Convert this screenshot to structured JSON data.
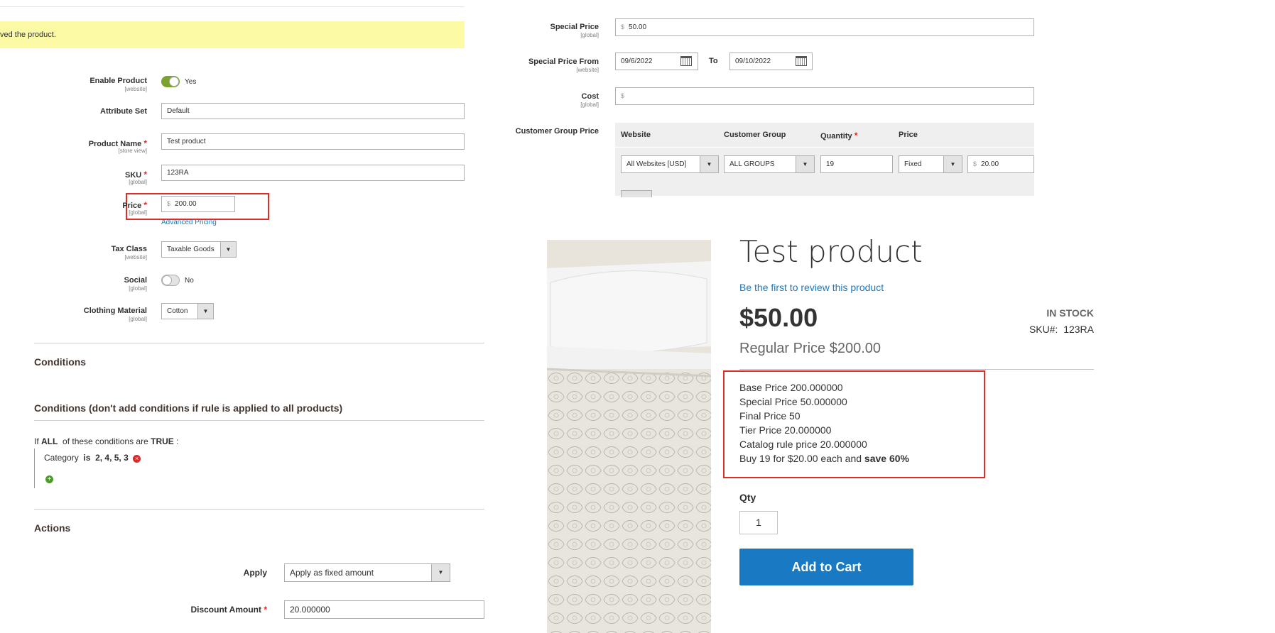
{
  "admin": {
    "success_message": "ved the product.",
    "fields": {
      "enable_product": {
        "label": "Enable Product",
        "scope": "[website]",
        "value": "Yes"
      },
      "attribute_set": {
        "label": "Attribute Set",
        "value": "Default"
      },
      "product_name": {
        "label": "Product Name",
        "scope": "[store view]",
        "value": "Test product"
      },
      "sku": {
        "label": "SKU",
        "scope": "[global]",
        "value": "123RA"
      },
      "price": {
        "label": "Price",
        "scope": "[global]",
        "currency": "$",
        "value": "200.00",
        "advanced_link": "Advanced Pricing"
      },
      "tax_class": {
        "label": "Tax Class",
        "scope": "[website]",
        "value": "Taxable Goods"
      },
      "social": {
        "label": "Social",
        "scope": "[global]",
        "value": "No"
      },
      "clothing_material": {
        "label": "Clothing Material",
        "scope": "[global]",
        "value": "Cotton"
      }
    },
    "required_mark": "*",
    "conditions": {
      "title": "Conditions",
      "subtitle": "Conditions (don't add conditions if rule is applied to all products)",
      "rule_if": "If",
      "rule_all": "ALL",
      "rule_mid": "of these conditions are",
      "rule_true": "TRUE",
      "rule_colon": ":",
      "cond_attr": "Category",
      "cond_op": "is",
      "cond_val": "2, 4, 5, 3"
    },
    "actions": {
      "title": "Actions",
      "apply_label": "Apply",
      "apply_value": "Apply as fixed amount",
      "discount_label": "Discount Amount",
      "discount_value": "20.000000"
    }
  },
  "advanced_pricing": {
    "special_price": {
      "label": "Special Price",
      "scope": "[global]",
      "currency": "$",
      "value": "50.00"
    },
    "special_from": {
      "label": "Special Price From",
      "scope": "[website]",
      "value": "09/6/2022",
      "to_label": "To",
      "to_value": "09/10/2022"
    },
    "cost": {
      "label": "Cost",
      "scope": "[global]",
      "currency": "$",
      "value": ""
    },
    "customer_group_price": {
      "label": "Customer Group Price",
      "headers": {
        "website": "Website",
        "group": "Customer Group",
        "qty": "Quantity",
        "price": "Price"
      },
      "row": {
        "website": "All Websites [USD]",
        "group": "ALL GROUPS",
        "qty": "19",
        "price_type": "Fixed",
        "currency": "$",
        "price": "20.00"
      }
    }
  },
  "storefront": {
    "title": "Test product",
    "review_link": "Be the first to review this product",
    "price": "$50.00",
    "regular_price": "Regular Price $200.00",
    "stock": "IN STOCK",
    "sku_label": "SKU#:",
    "sku_value": "123RA",
    "debug_lines": [
      "Base Price 200.000000",
      "Special Price 50.000000",
      "Final Price 50",
      "Tier Price 20.000000",
      "Catalog rule price 20.000000"
    ],
    "tier_text": "Buy 19 for $20.00 each and",
    "tier_save": "save 60%",
    "qty_label": "Qty",
    "qty_value": "1",
    "add_to_cart": "Add to Cart"
  },
  "colors": {
    "accent": "#1979c3",
    "highlight_box": "#e02b27",
    "message_bg": "#fdfaa6",
    "toggle_on": "#79a22e"
  }
}
